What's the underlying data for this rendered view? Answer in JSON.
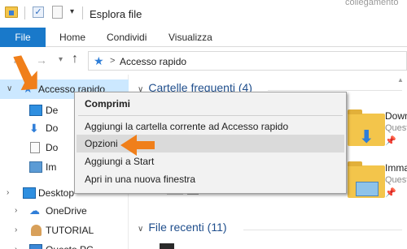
{
  "window": {
    "title": "Esplora file",
    "background_text": "collegamento"
  },
  "ribbon": {
    "tabs": [
      "File",
      "Home",
      "Condividi",
      "Visualizza"
    ]
  },
  "address": {
    "path": "Accesso rapido",
    "separator": ">"
  },
  "nav_pane": {
    "items": [
      {
        "label": "Accesso rapido",
        "icon": "star-icon",
        "selected": true
      },
      {
        "label": "De",
        "icon": "desktop-icon"
      },
      {
        "label": "Do",
        "icon": "download-icon"
      },
      {
        "label": "Do",
        "icon": "document-icon"
      },
      {
        "label": "Im",
        "icon": "image-icon"
      },
      {
        "label": "Desktop",
        "icon": "desktop-icon"
      },
      {
        "label": "OneDrive",
        "icon": "cloud-icon"
      },
      {
        "label": "TUTORIAL",
        "icon": "user-icon"
      },
      {
        "label": "Questo PC",
        "icon": "pc-icon"
      }
    ]
  },
  "main": {
    "frequent_header": "Cartelle frequenti (4)",
    "recent_header": "File recenti (11)",
    "tiles": [
      {
        "name": "Down",
        "sub": "Quest"
      },
      {
        "name": "Imma",
        "sub": "Quest"
      }
    ]
  },
  "context_menu": {
    "items": [
      "Comprimi",
      "Aggiungi la cartella corrente ad Accesso rapido",
      "Opzioni",
      "Aggiungi a Start",
      "Apri in una nuova finestra"
    ],
    "highlighted": "Opzioni"
  },
  "colors": {
    "accent": "#1979ca",
    "selection": "#cce8ff",
    "arrow": "#f07f1a",
    "folder": "#f3c54b"
  }
}
